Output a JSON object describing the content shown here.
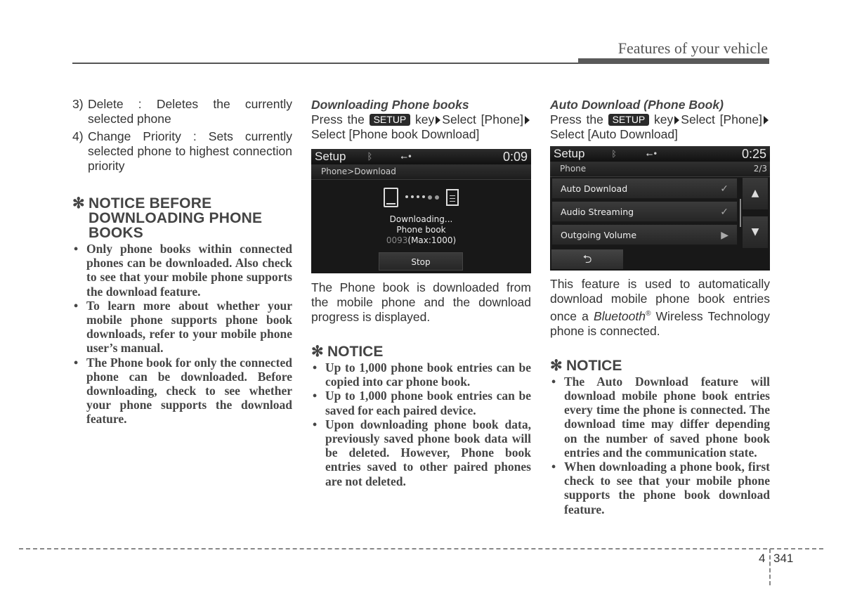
{
  "header": {
    "title": "Features of your vehicle"
  },
  "col1": {
    "items": [
      {
        "num": "3)",
        "text": "Delete : Deletes the currently selected phone"
      },
      {
        "num": "4)",
        "text": "Change Priority : Sets currently selected phone to highest connection priority"
      }
    ],
    "notice": {
      "star": "✻",
      "title": "NOTICE BEFORE DOWNLOADING PHONE BOOKS",
      "bullets": [
        "Only phone books within connected phones can be downloaded. Also check to see that your mobile phone supports the download feature.",
        "To learn more about whether your mobile phone supports phone book downloads, refer to your mobile phone user’s manual.",
        "The Phone book for only the connected phone can be downloaded. Before downloading, check to see whether your phone supports the download feature."
      ]
    }
  },
  "col2": {
    "heading": "Downloading Phone books",
    "instr": {
      "press": "Press the",
      "key": "SETUP",
      "after_key": "key",
      "step1": "Select [Phone]",
      "step2": "Select [Phone book Download]"
    },
    "screen": {
      "title": "Setup",
      "clock": "0:09",
      "breadcrumb": "Phone>Download",
      "line1": "Downloading...",
      "line2": "Phone book",
      "count": "0093",
      "max": "(Max:1000)",
      "stop_label": "Stop",
      "progress": {
        "current": 93,
        "max": 1000
      }
    },
    "desc": "The Phone book is downloaded from the mobile phone and the download progress is displayed.",
    "notice": {
      "star": "✻",
      "title": "NOTICE",
      "bullets": [
        "Up to 1,000 phone book entries can be copied into car phone book.",
        "Up to 1,000 phone book entries can be saved for each paired device.",
        "Upon downloading phone book data, previously saved phone book data will be deleted. However, Phone book entries saved to other paired phones are not deleted."
      ]
    }
  },
  "col3": {
    "heading": "Auto Download (Phone Book)",
    "instr": {
      "press": "Press the",
      "key": "SETUP",
      "after_key": "key",
      "step1": "Select [Phone]",
      "step2": "Select [Auto Download]"
    },
    "screen": {
      "title": "Setup",
      "clock": "0:25",
      "section": "Phone",
      "page": "2/3",
      "rows": [
        {
          "label": "Auto Download",
          "indicator": "✓"
        },
        {
          "label": "Audio Streaming",
          "indicator": "✓"
        },
        {
          "label": "Outgoing Volume",
          "indicator": "▶"
        }
      ],
      "up": "▲",
      "down": "▼",
      "back": "⮌"
    },
    "desc_part1": "This feature is used to automatically download mobile phone book entries once a",
    "desc_brand": "Bluetooth",
    "desc_reg": "®",
    "desc_part2": "Wireless Technology phone is connected.",
    "notice": {
      "star": "✻",
      "title": "NOTICE",
      "bullets": [
        "The Auto Download feature will download mobile phone book entries every time the phone is connected. The download time may differ depending on the number of saved phone book entries and the communication state.",
        "When downloading a phone book, first check to see that your mobile phone supports the phone book download feature."
      ]
    }
  },
  "footer": {
    "chapter": "4",
    "page": "341"
  }
}
